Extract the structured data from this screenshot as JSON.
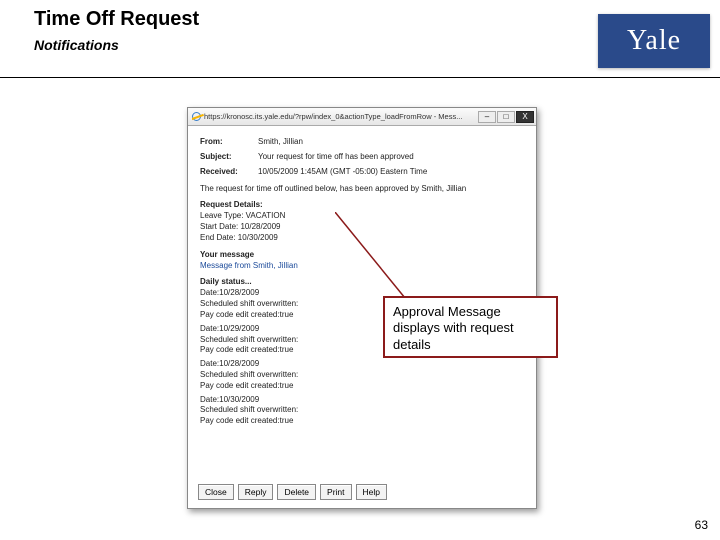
{
  "header": {
    "title": "Time Off Request",
    "subtitle": "Notifications"
  },
  "logo": {
    "text": "Yale"
  },
  "window": {
    "url": "https://kronosc.its.yale.edu/?rpw/index_0&actionType_loadFromRow - Mess...",
    "from_label": "From:",
    "from_value": "Smith, Jillian",
    "subject_label": "Subject:",
    "subject_value": "Your request for time off has been approved",
    "received_label": "Received:",
    "received_value": "10/05/2009 1:45AM (GMT -05:00) Eastern Time",
    "intro": "The request for time off outlined below, has been approved by Smith, Jillian",
    "details_header": "Request Details:",
    "leave_type": "Leave Type: VACATION",
    "start_date": "Start Date: 10/28/2009",
    "end_date": "End Date: 10/30/2009",
    "your_message_header": "Your message",
    "your_message": "Message from Smith, Jillian",
    "daily_header": "Daily status...",
    "days": [
      {
        "date": "Date:10/28/2009",
        "l1": "Scheduled shift overwritten:",
        "l2": "Pay code edit created:true"
      },
      {
        "date": "Date:10/29/2009",
        "l1": "Scheduled shift overwritten:",
        "l2": "Pay code edit created:true"
      },
      {
        "date": "Date:10/28/2009",
        "l1": "Scheduled shift overwritten:",
        "l2": "Pay code edit created:true"
      },
      {
        "date": "Date:10/30/2009",
        "l1": "Scheduled shift overwritten:",
        "l2": "Pay code edit created:true"
      }
    ],
    "buttons": {
      "close": "Close",
      "reply": "Reply",
      "delete": "Delete",
      "print": "Print",
      "help": "Help"
    }
  },
  "callout": "Approval Message displays with request details",
  "page_number": "63"
}
